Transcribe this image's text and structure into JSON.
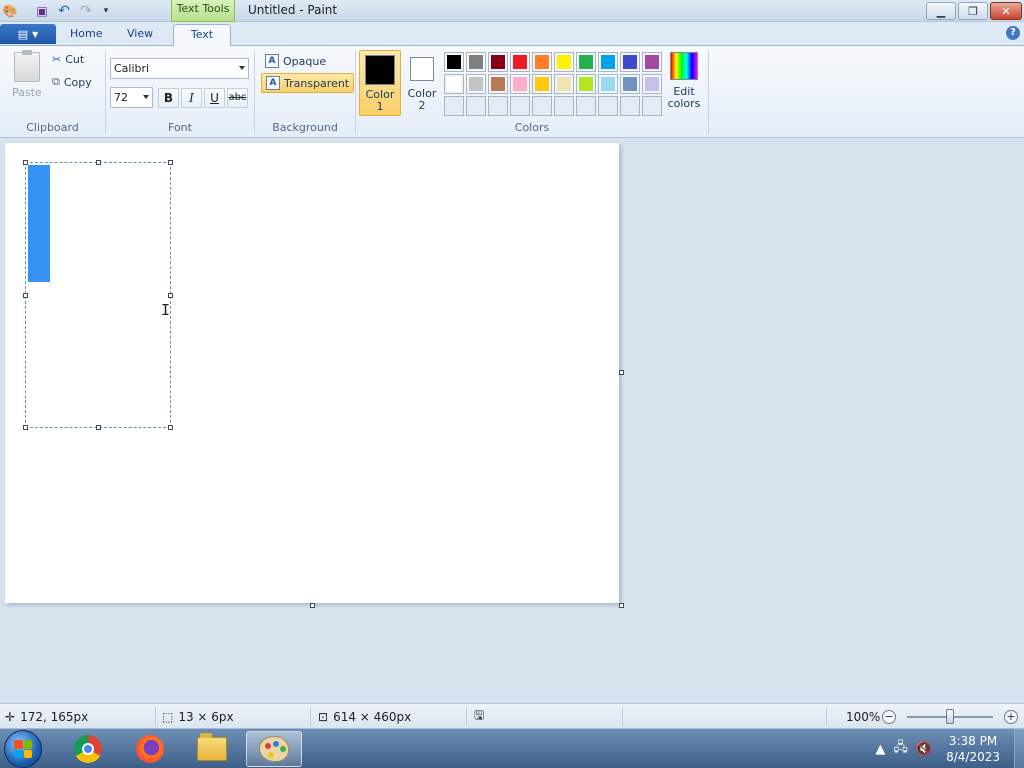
{
  "window": {
    "title": "Untitled - Paint",
    "contextual_tab": "Text Tools"
  },
  "quick_access": {
    "icons": [
      "paint-app-icon",
      "save-icon",
      "undo-icon",
      "redo-icon",
      "customize-qat-icon"
    ]
  },
  "tabs": {
    "home": "Home",
    "view": "View",
    "text": "Text",
    "active": "Text"
  },
  "ribbon": {
    "clipboard": {
      "label": "Clipboard",
      "paste": "Paste",
      "cut": "Cut",
      "copy": "Copy"
    },
    "font": {
      "label": "Font",
      "family": "Calibri",
      "size": "72",
      "bold": "B",
      "italic": "I",
      "underline": "U",
      "strike": "abc"
    },
    "background": {
      "label": "Background",
      "opaque": "Opaque",
      "transparent": "Transparent",
      "selected": "Transparent"
    },
    "colors": {
      "label": "Colors",
      "color1_line1": "Color",
      "color1_line2": "1",
      "color2_line1": "Color",
      "color2_line2": "2",
      "color1_value": "#000000",
      "color2_value": "#ffffff",
      "edit_line1": "Edit",
      "edit_line2": "colors",
      "palette_row1": [
        "#000000",
        "#7f7f7f",
        "#880015",
        "#ed1c24",
        "#ff7f27",
        "#fff200",
        "#22b14c",
        "#00a2e8",
        "#3f48cc",
        "#a349a4"
      ],
      "palette_row2": [
        "#ffffff",
        "#c3c3c3",
        "#b97a57",
        "#ffaec9",
        "#ffc90e",
        "#efe4b0",
        "#b5e61d",
        "#99d9ea",
        "#7092be",
        "#c8bfe7"
      ]
    }
  },
  "status": {
    "cursor_pos": "172, 165px",
    "selection_size": "13 × 6px",
    "canvas_size": "614 × 460px",
    "zoom": "100%",
    "zoom_fraction": 0.5
  },
  "taskbar": {
    "apps": [
      "chrome",
      "firefox",
      "file-explorer",
      "paint"
    ],
    "active_app": "paint",
    "time": "3:38 PM",
    "date": "8/4/2023"
  }
}
